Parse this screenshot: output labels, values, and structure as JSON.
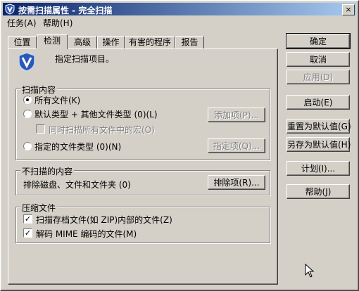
{
  "window": {
    "title": "按需扫描属性 - 完全扫描",
    "close_glyph": "×"
  },
  "menu": {
    "items": [
      "任务(A)",
      "帮助(H)"
    ]
  },
  "tabs": [
    "位置",
    "检测",
    "高级",
    "操作",
    "有害的程序",
    "报告"
  ],
  "header": {
    "description": "指定扫描项目。"
  },
  "scan_content": {
    "legend": "扫描内容",
    "all_files": "所有文件(K)",
    "default_types": "默认类型 + 其他文件类型 (0)(L)",
    "add_button": "添加项(P)...",
    "macros": "同时扫描所有文件中的宏(O)",
    "specified_types": "指定的文件类型 (0)(N)",
    "specify_button": "指定项(Q)..."
  },
  "exclusions": {
    "legend": "不扫描的内容",
    "label": "排除磁盘、文件和文件夹 (0)",
    "button": "排除项(R)..."
  },
  "compressed": {
    "legend": "压缩文件",
    "archives": "扫描存档文件(如 ZIP)内部的文件(Z)",
    "mime": "解码 MIME 编码的文件(M)"
  },
  "buttons": {
    "ok": "确定",
    "cancel": "取消",
    "apply": "应用(D)",
    "start": "启动(E)",
    "reset": "重置为默认值(G)",
    "save_default": "另存为默认值(H)",
    "schedule": "计划(I)...",
    "help": "帮助(J)"
  },
  "colors": {
    "title_start": "#0a246a",
    "title_end": "#a6caf0",
    "face": "#d4d0c8",
    "shield": "#2b58b8"
  }
}
